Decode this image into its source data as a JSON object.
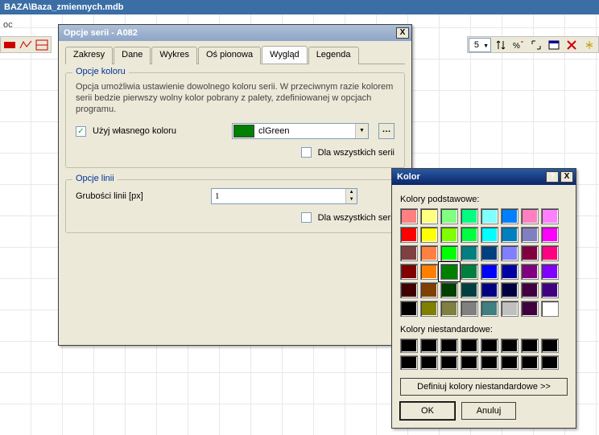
{
  "titlebar": {
    "text": "BAZA\\Baza_zmiennych.mdb"
  },
  "left_label": "oc",
  "toolbar_right": {
    "dropdown_value": "5"
  },
  "series_dialog": {
    "title": "Opcje serii - A082",
    "close_glyph": "X",
    "tabs": [
      {
        "label": "Zakresy",
        "selected": false
      },
      {
        "label": "Dane",
        "selected": false
      },
      {
        "label": "Wykres",
        "selected": false
      },
      {
        "label": "Oś pionowa",
        "selected": false
      },
      {
        "label": "Wygląd",
        "selected": true
      },
      {
        "label": "Legenda",
        "selected": false
      }
    ],
    "color_group": {
      "legend": "Opcje koloru",
      "help": "Opcja umożliwia ustawienie dowolnego koloru serii. W przeciwnym razie kolorem serii bedzie pierwszy wolny kolor pobrany z palety, zdefiniowanej w opcjach programu.",
      "use_own_color_label": "Użyj własnego koloru",
      "use_own_color_checked": true,
      "color_name": "clGreen",
      "for_all_label": "Dla wszystkich serii",
      "for_all_checked": false
    },
    "line_group": {
      "legend": "Opcje linii",
      "thickness_label": "Grubości linii [px]",
      "thickness_value": "1",
      "for_all_label": "Dla wszystkich serii",
      "for_all_checked": false
    }
  },
  "kolor_dialog": {
    "title": "Kolor",
    "help_glyph": "?",
    "close_glyph": "X",
    "basic_label": "Kolory podstawowe:",
    "basic_colors": [
      "#ff8080",
      "#ffff80",
      "#80ff80",
      "#00ff80",
      "#80ffff",
      "#0080ff",
      "#ff80c0",
      "#ff80ff",
      "#ff0000",
      "#ffff00",
      "#80ff00",
      "#00ff40",
      "#00ffff",
      "#0080c0",
      "#8080c0",
      "#ff00ff",
      "#804040",
      "#ff8040",
      "#00ff00",
      "#008080",
      "#004080",
      "#8080ff",
      "#800040",
      "#ff0080",
      "#800000",
      "#ff8000",
      "#008000",
      "#008040",
      "#0000ff",
      "#0000a0",
      "#800080",
      "#8000ff",
      "#400000",
      "#804000",
      "#004000",
      "#004040",
      "#000080",
      "#000040",
      "#400040",
      "#400080",
      "#000000",
      "#808000",
      "#808040",
      "#808080",
      "#408080",
      "#c0c0c0",
      "#400040",
      "#ffffff"
    ],
    "selected_index": 26,
    "custom_label": "Kolory niestandardowe:",
    "define_label": "Definiuj kolory niestandardowe >>",
    "ok_label": "OK",
    "cancel_label": "Anuluj"
  }
}
